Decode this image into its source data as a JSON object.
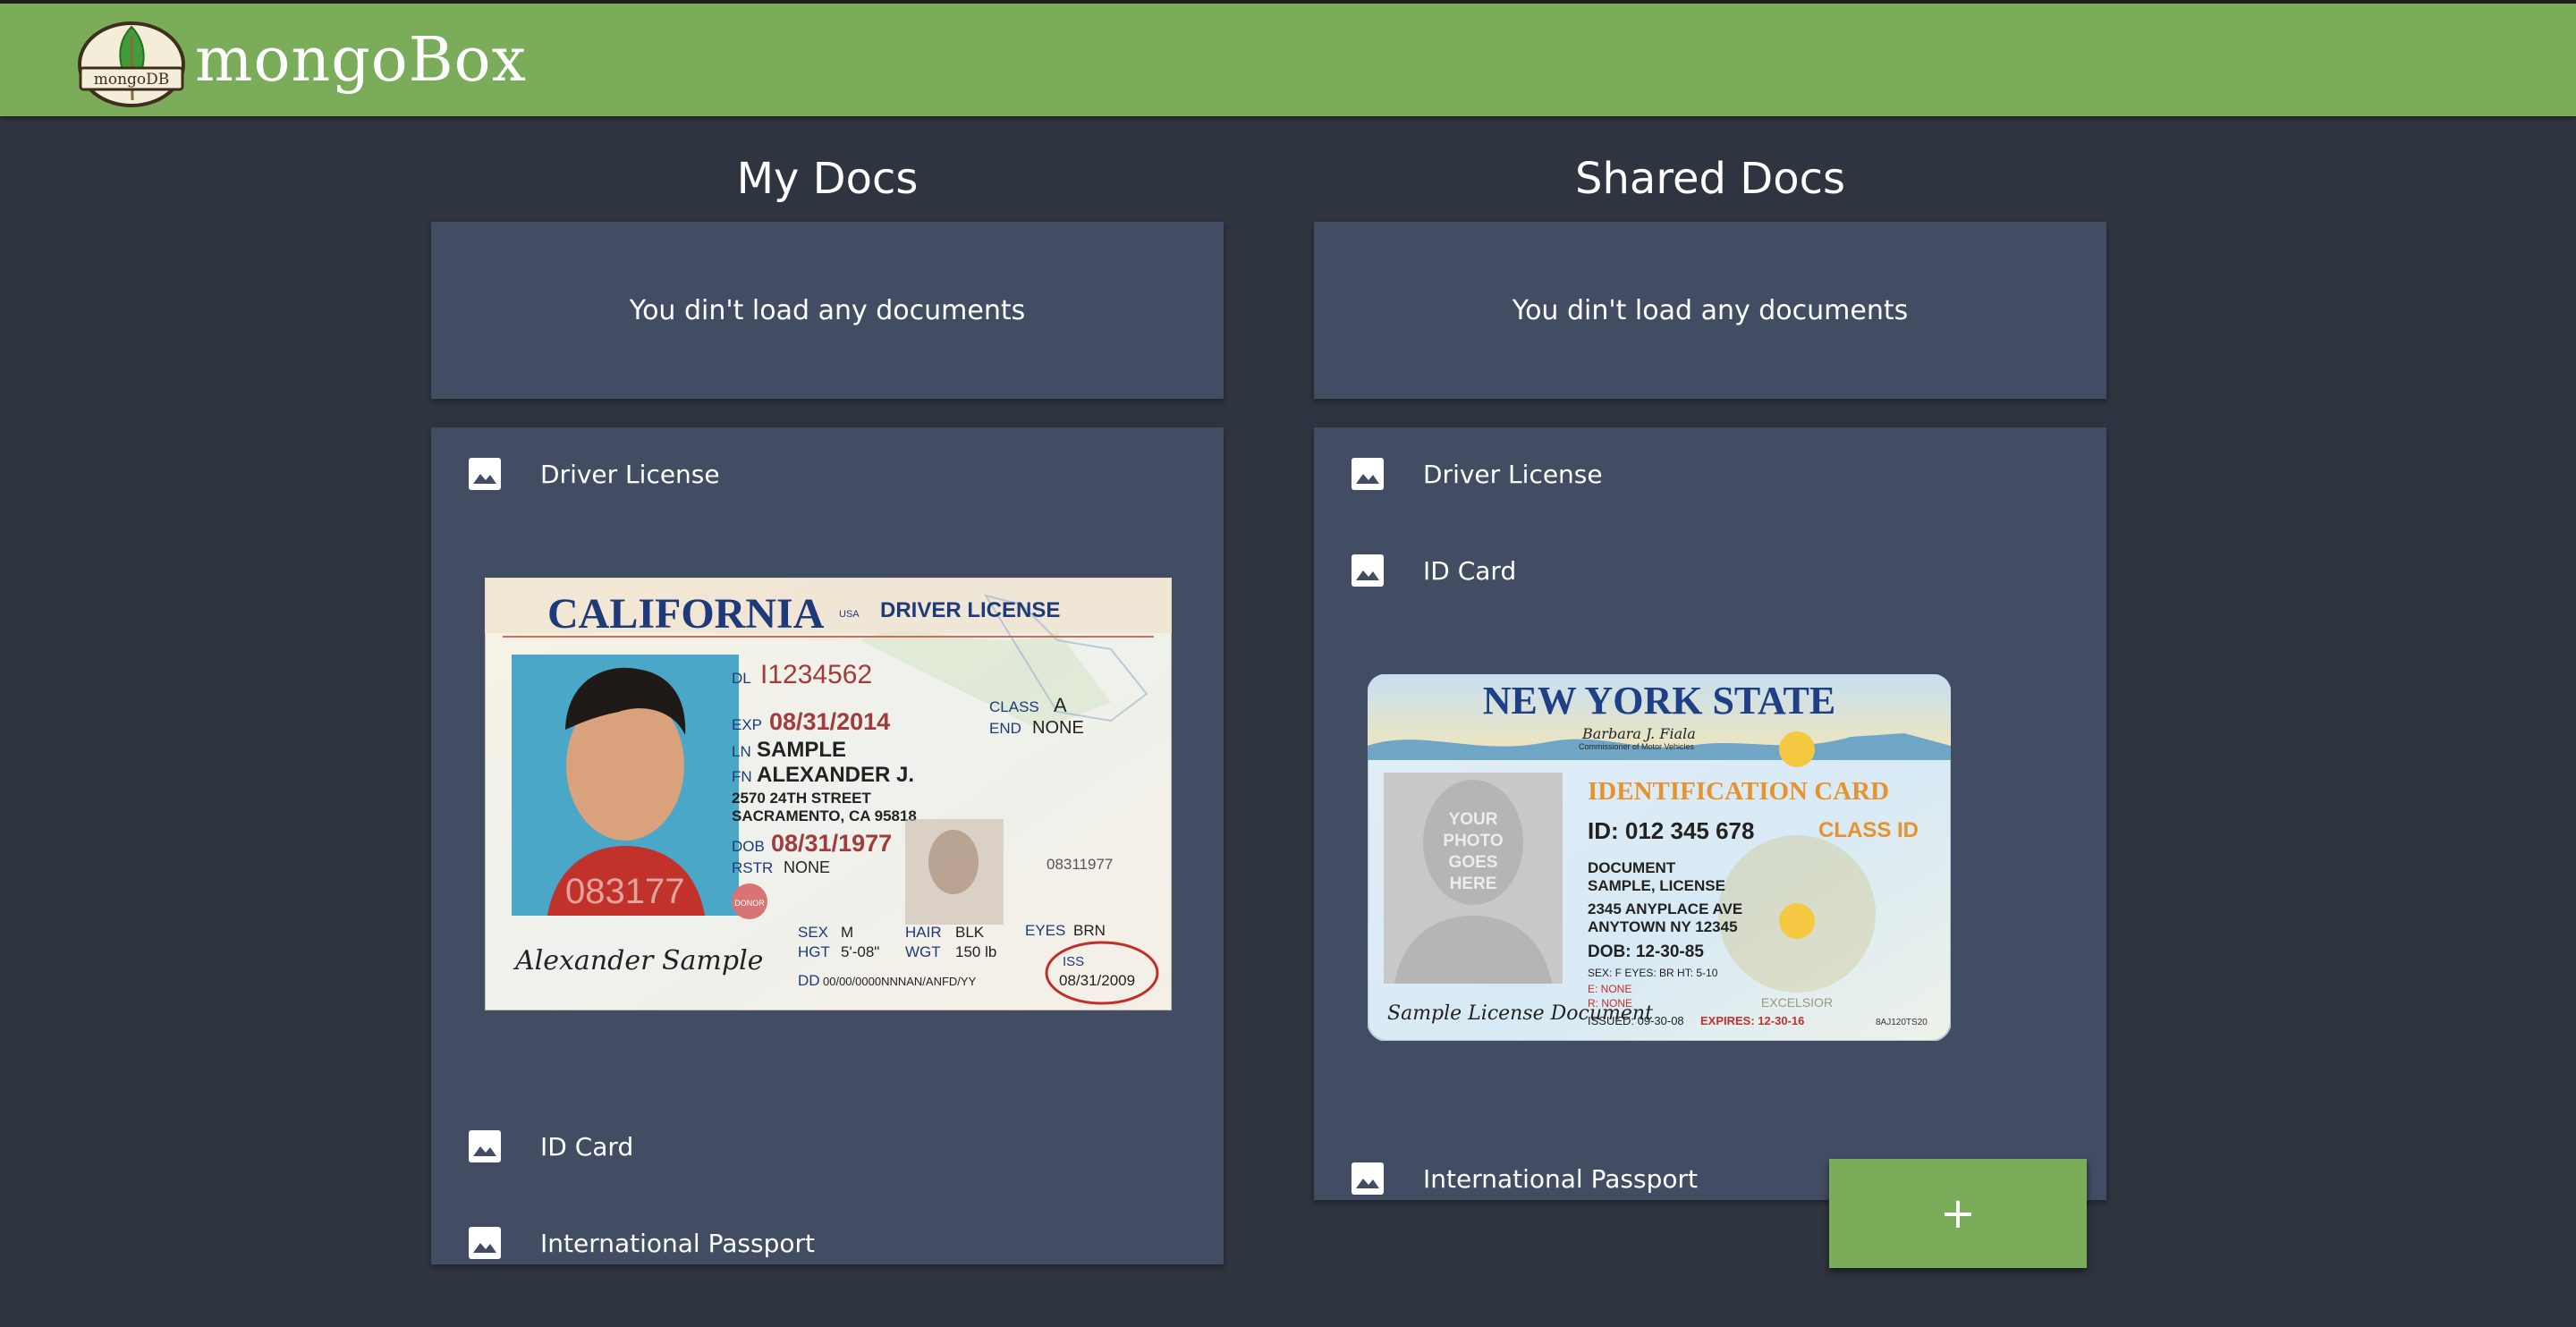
{
  "header": {
    "brand": "mongoBox",
    "logo_text": "mongoDB",
    "accent": "#7aac59"
  },
  "my_docs": {
    "title": "My Docs",
    "empty_message": "You din't load any documents",
    "items": [
      {
        "label": "Driver License",
        "icon": "image-icon",
        "expanded": true
      },
      {
        "label": "ID Card",
        "icon": "image-icon",
        "expanded": false
      },
      {
        "label": "International Passport",
        "icon": "image-icon",
        "expanded": false
      }
    ],
    "preview": {
      "state": "CALIFORNIA",
      "state_suffix": "USA",
      "type": "DRIVER LICENSE",
      "dl_label": "DL",
      "dl": "I1234562",
      "exp_label": "EXP",
      "exp": "08/31/2014",
      "class_label": "CLASS",
      "class": "A",
      "end_label": "END",
      "end": "NONE",
      "ln_label": "LN",
      "ln": "SAMPLE",
      "fn_label": "FN",
      "fn": "ALEXANDER J.",
      "addr1": "2570 24TH STREET",
      "addr2": "SACRAMENTO, CA 95818",
      "dob_label": "DOB",
      "dob": "08/31/1977",
      "rstr_label": "RSTR",
      "rstr": "NONE",
      "ghost_no": "083177",
      "side_no": "08311977",
      "donor": "DONOR",
      "sex_label": "SEX",
      "sex": "M",
      "hair_label": "HAIR",
      "hair": "BLK",
      "eyes_label": "EYES",
      "eyes": "BRN",
      "hgt_label": "HGT",
      "hgt": "5'-08\"",
      "wgt_label": "WGT",
      "wgt": "150 lb",
      "iss_label": "ISS",
      "iss": "08/31/2009",
      "dd_label": "DD",
      "dd": "00/00/0000NNNAN/ANFD/YY",
      "signature": "Alexander Sample"
    }
  },
  "shared_docs": {
    "title": "Shared Docs",
    "empty_message": "You din't load any documents",
    "items": [
      {
        "label": "Driver License",
        "icon": "image-icon",
        "expanded": false
      },
      {
        "label": "ID Card",
        "icon": "image-icon",
        "expanded": true
      },
      {
        "label": "International Passport",
        "icon": "image-icon",
        "expanded": false
      }
    ],
    "preview": {
      "state": "NEW YORK STATE",
      "commissioner_sig": "Barbara J. Fiala",
      "commissioner": "Commissioner of Motor Vehicles",
      "photo_placeholder": [
        "YOUR",
        "PHOTO",
        "GOES",
        "HERE"
      ],
      "type": "IDENTIFICATION CARD",
      "id_line": "ID: 012 345 678",
      "class_id": "CLASS ID",
      "name1": "DOCUMENT",
      "name2": "SAMPLE, LICENSE",
      "addr1": "2345 ANYPLACE AVE",
      "addr2": "ANYTOWN NY 12345",
      "dob": "DOB: 12-30-85",
      "sex_line": "SEX: F   EYES: BR   HT: 5-10",
      "e_line": "E: NONE",
      "r_line": "R: NONE",
      "issued": "ISSUED: 09-30-08",
      "expires": "EXPIRES: 12-30-16",
      "code": "8AJ120TS20",
      "seal_text": "EXCELSIOR",
      "signature": "Sample License Document"
    }
  },
  "fab": {
    "label": "+"
  }
}
